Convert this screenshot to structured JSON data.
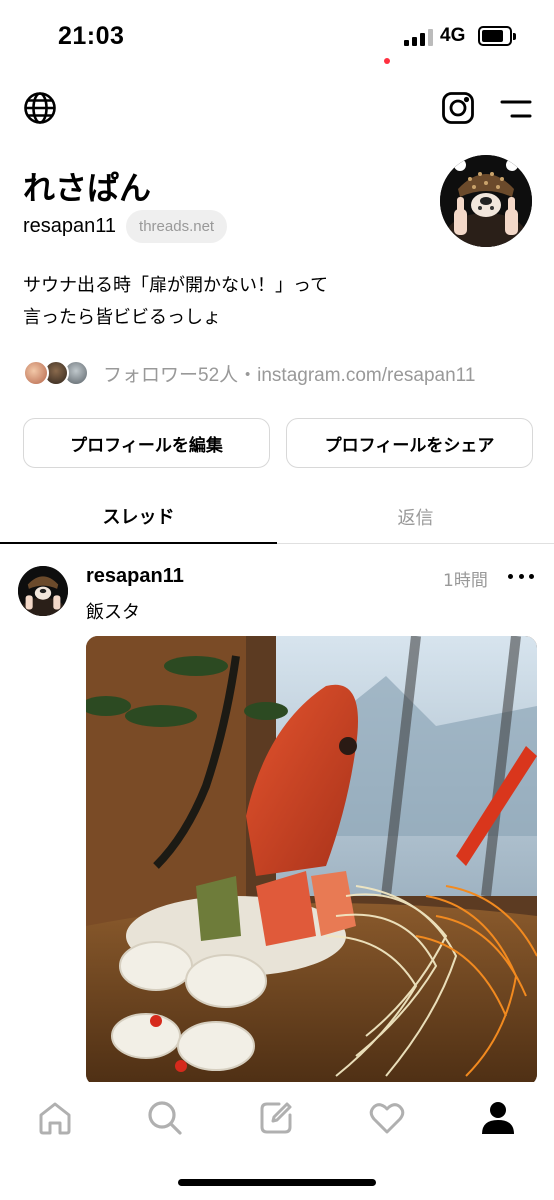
{
  "status_bar": {
    "time": "21:03",
    "network": "4G"
  },
  "profile": {
    "display_name": "れさぱん",
    "handle": "resapan11",
    "domain_badge": "threads.net",
    "bio_line1": "サウナ出る時「扉が開かない！」って",
    "bio_line2": "言ったら皆ビビるっしょ",
    "followers_text": "フォロワー52人・instagram.com/resapan11"
  },
  "buttons": {
    "edit_profile": "プロフィールを編集",
    "share_profile": "プロフィールをシェア"
  },
  "tabs": [
    {
      "label": "スレッド",
      "active": true
    },
    {
      "label": "返信",
      "active": false
    }
  ],
  "post": {
    "username": "resapan11",
    "time": "1時間",
    "text": "飯スタ"
  },
  "icons": {
    "top_left": "globe-icon",
    "top_right_1": "instagram-icon",
    "top_right_2": "menu-icon",
    "bottom": [
      "home-icon",
      "search-icon",
      "compose-icon",
      "heart-icon",
      "profile-icon"
    ]
  },
  "colors": {
    "muted_text": "#999999",
    "notification_dot": "#ff3040",
    "border": "#d8d8d8"
  }
}
